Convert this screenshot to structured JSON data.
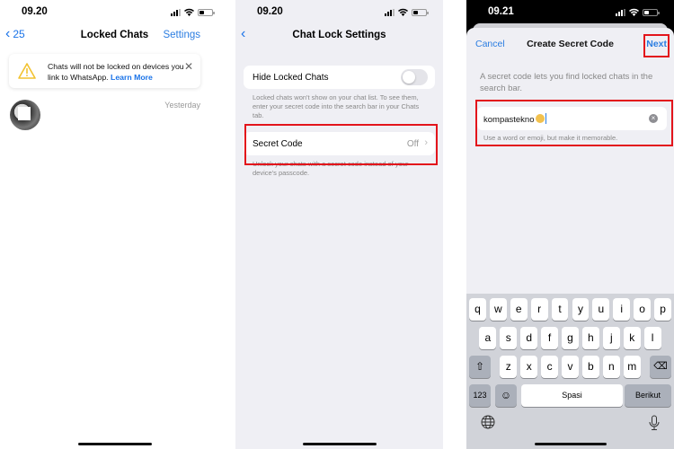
{
  "panel1": {
    "status": {
      "time": "09.20"
    },
    "nav": {
      "back_label": "25",
      "title": "Locked Chats",
      "right_label": "Settings"
    },
    "banner": {
      "message": "Chats will not be locked on devices you link to WhatsApp.",
      "link": "Learn More",
      "icon": "warning-icon"
    },
    "chats": [
      {
        "name": "",
        "time": "Yesterday"
      }
    ]
  },
  "panel2": {
    "status": {
      "time": "09.20"
    },
    "nav": {
      "title": "Chat Lock Settings"
    },
    "hide_locked": {
      "label": "Hide Locked Chats",
      "enabled": false,
      "footnote": "Locked chats won't show on your chat list. To see them, enter your secret code into the search bar in your Chats tab."
    },
    "secret_code": {
      "label": "Secret Code",
      "value": "Off",
      "footnote": "Unlock your chats with a secret code instead of your device's passcode."
    }
  },
  "panel3": {
    "status": {
      "time": "09.21"
    },
    "sheet": {
      "cancel_label": "Cancel",
      "title": "Create Secret Code",
      "next_label": "Next",
      "description": "A secret code lets you find locked chats in the search bar.",
      "input_value": "kompastekno",
      "input_emoji": "grimacing-face-emoji",
      "hint": "Use a word or emoji, but make it memorable."
    },
    "keyboard": {
      "row1": [
        "q",
        "w",
        "e",
        "r",
        "t",
        "y",
        "u",
        "i",
        "o",
        "p"
      ],
      "row2": [
        "a",
        "s",
        "d",
        "f",
        "g",
        "h",
        "j",
        "k",
        "l"
      ],
      "row3": [
        "z",
        "x",
        "c",
        "v",
        "b",
        "n",
        "m"
      ],
      "numbers_label": "123",
      "space_label": "Spasi",
      "return_label": "Berikut"
    }
  },
  "colors": {
    "accent": "#2b7de1",
    "highlight": "#e3141b",
    "warning": "#f2c230"
  }
}
